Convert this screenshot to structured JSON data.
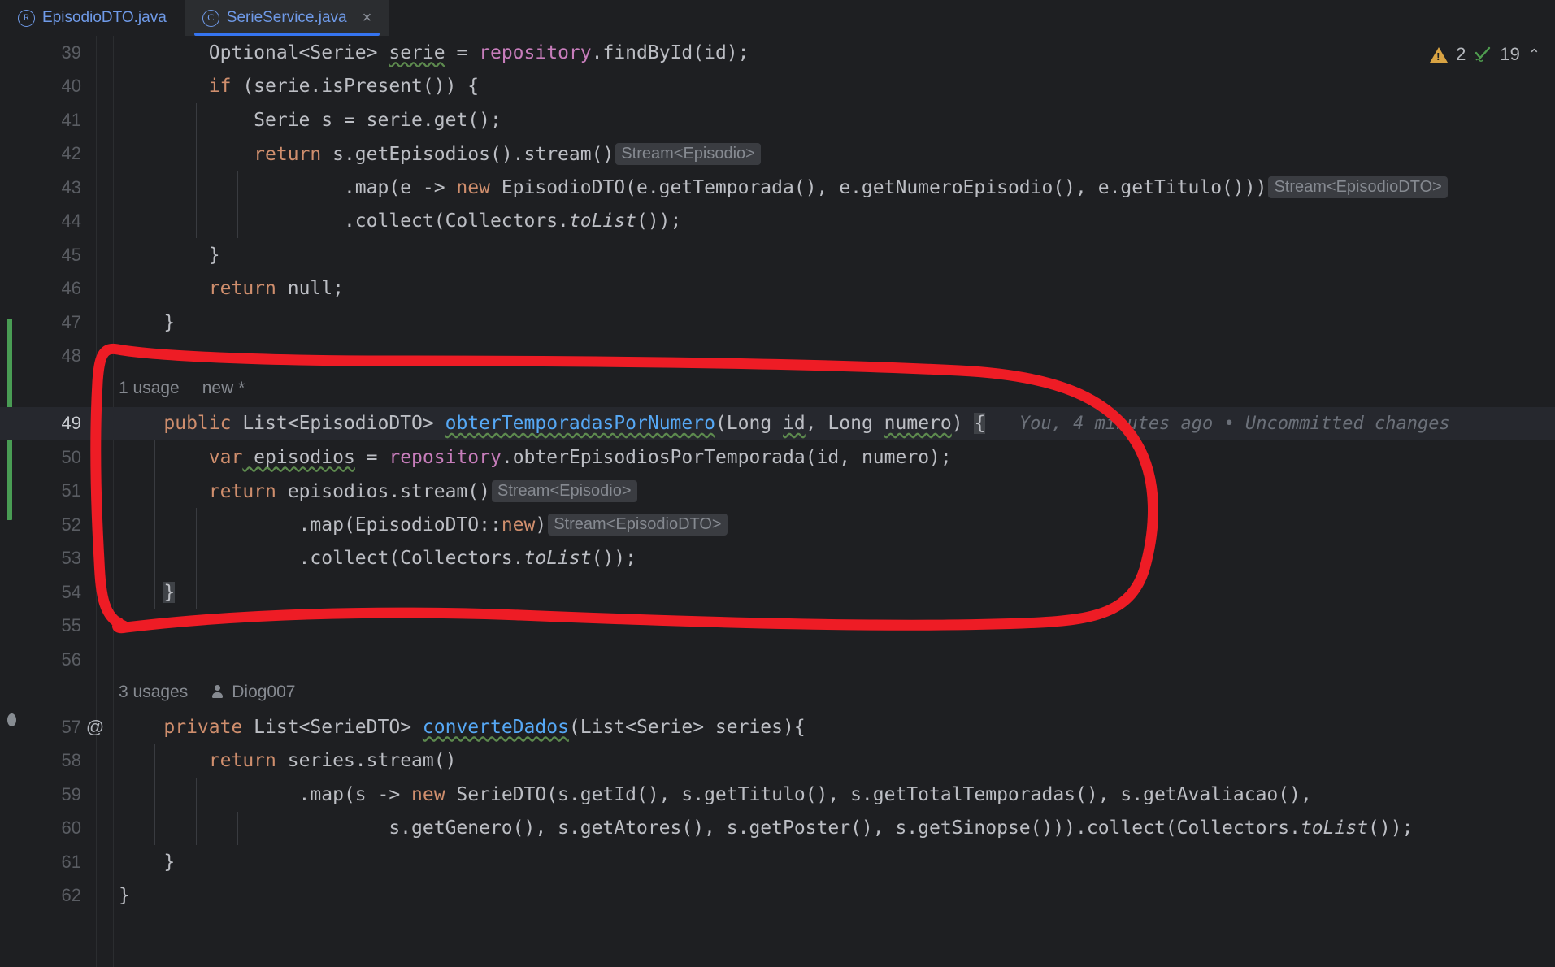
{
  "window": {
    "theme": "dark",
    "accent": "#3574f0",
    "annotation_color": "#ee1c25"
  },
  "tabs": [
    {
      "label": "EpisodioDTO.java",
      "icon": "record-class-icon",
      "icon_glyph": "R",
      "active": false,
      "closable": false
    },
    {
      "label": "SerieService.java",
      "icon": "java-class-icon",
      "icon_glyph": "C",
      "active": true,
      "closable": true,
      "close_glyph": "×"
    }
  ],
  "inspection_widget": {
    "warning_icon": "warning-triangle-icon",
    "warning_count": "2",
    "ok_icon": "green-check-icon",
    "ok_count": "19",
    "chevron_icon": "chevron-up-icon",
    "chevron_glyph": "⌃"
  },
  "editor": {
    "current_line": "49",
    "gutter_markers": [
      {
        "line": "57",
        "glyph": "@",
        "name": "annotation-gutter-icon"
      }
    ],
    "blame": {
      "line": "49",
      "text": "You, 4 minutes ago • Uncommitted changes"
    },
    "code_vision": [
      {
        "above_line": "49",
        "usages": "1 usage",
        "author": "new *",
        "author_icon": "none"
      },
      {
        "above_line": "57",
        "usages": "3 usages",
        "author": "Diog007",
        "author_icon": "person-icon"
      }
    ],
    "lines": [
      {
        "n": "39",
        "text": "        Optional<Serie> serie = repository.findById(id);"
      },
      {
        "n": "40",
        "text": "        if (serie.isPresent()) {"
      },
      {
        "n": "41",
        "text": "            Serie s = serie.get();"
      },
      {
        "n": "42",
        "text": "            return s.getEpisodios().stream()",
        "inlay": "Stream<Episodio>"
      },
      {
        "n": "43",
        "text": "                    .map(e -> new EpisodioDTO(e.getTemporada(), e.getNumeroEpisodio(), e.getTitulo()))",
        "inlay": "Stream<EpisodioDTO>"
      },
      {
        "n": "44",
        "text": "                    .collect(Collectors.toList());"
      },
      {
        "n": "45",
        "text": "        }"
      },
      {
        "n": "46",
        "text": "        return null;"
      },
      {
        "n": "47",
        "text": "    }"
      },
      {
        "n": "48",
        "text": ""
      },
      {
        "n": "49",
        "text": "    public List<EpisodioDTO> obterTemporadasPorNumero(Long id, Long numero) {"
      },
      {
        "n": "50",
        "text": "        var episodios = repository.obterEpisodiosPorTemporada(id, numero);"
      },
      {
        "n": "51",
        "text": "        return episodios.stream()",
        "inlay": "Stream<Episodio>"
      },
      {
        "n": "52",
        "text": "                .map(EpisodioDTO::new)",
        "inlay": "Stream<EpisodioDTO>"
      },
      {
        "n": "53",
        "text": "                .collect(Collectors.toList());"
      },
      {
        "n": "54",
        "text": "    }"
      },
      {
        "n": "55",
        "text": ""
      },
      {
        "n": "56",
        "text": ""
      },
      {
        "n": "57",
        "text": "    private List<SerieDTO> converteDados(List<Serie> series){"
      },
      {
        "n": "58",
        "text": "        return series.stream()"
      },
      {
        "n": "59",
        "text": "                .map(s -> new SerieDTO(s.getId(), s.getTitulo(), s.getTotalTemporadas(), s.getAvaliacao(),"
      },
      {
        "n": "60",
        "text": "                        s.getGenero(), s.getAtores(), s.getPoster(), s.getSinopse())).collect(Collectors.toList());"
      },
      {
        "n": "61",
        "text": "    }"
      },
      {
        "n": "62",
        "text": "}"
      }
    ],
    "vcs_change_marker": {
      "from_line": "49",
      "to_line": "55",
      "color": "#499c54"
    },
    "breakpoint_dot": {
      "line": "61"
    }
  }
}
